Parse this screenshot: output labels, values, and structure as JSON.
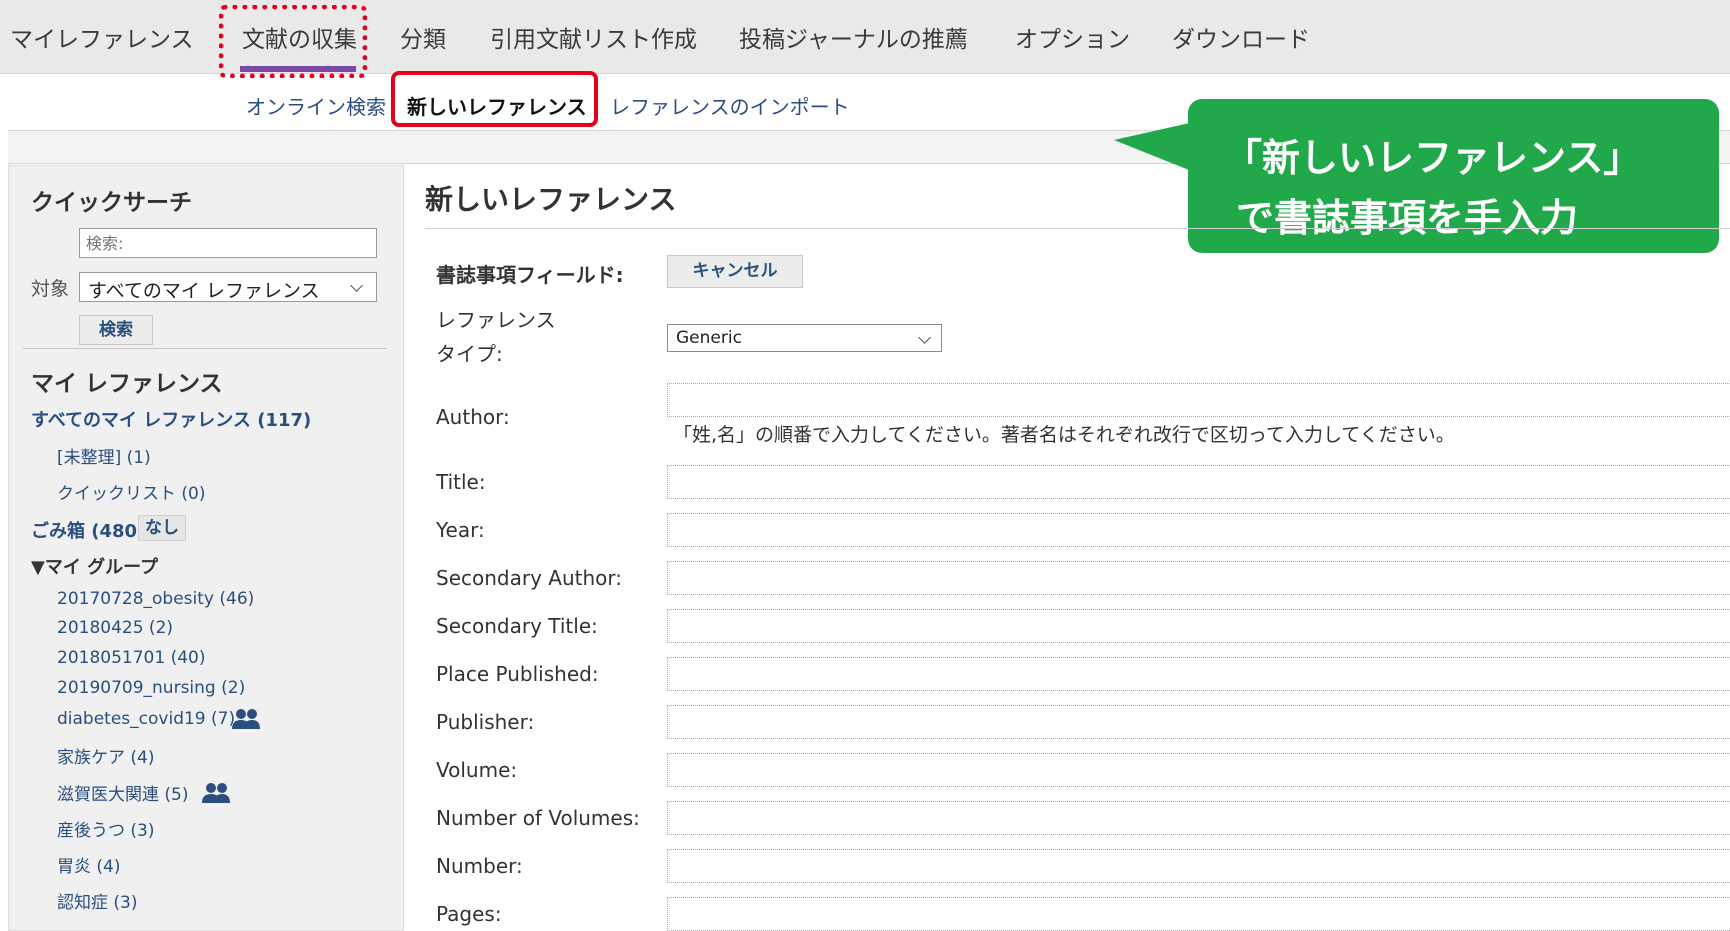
{
  "topnav": {
    "items": [
      "マイレファレンス",
      "文献の収集",
      "分類",
      "引用文献リスト作成",
      "投稿ジャーナルの推薦",
      "オプション",
      "ダウンロード"
    ]
  },
  "subnav": {
    "items": [
      "オンライン検索",
      "新しいレファレンス",
      "レファレンスのインポート"
    ]
  },
  "callout": {
    "line1": "「新しいレファレンス」",
    "line2": "で書誌事項を手入力",
    "color": "#21a84a"
  },
  "sidebar": {
    "quick_search_title": "クイックサーチ",
    "search_placeholder": "検索:",
    "target_label": "対象",
    "target_value": "すべてのマイ レファレンス",
    "search_button": "検索",
    "my_refs_title": "マイ レファレンス",
    "all_refs": "すべてのマイ レファレンス (117)",
    "unfiled": "[未整理] (1)",
    "quicklist": "クイックリスト (0)",
    "trash": "ごみ箱 (480)",
    "trash_empty": "なし",
    "my_groups": "▼マイ グループ",
    "groups": [
      {
        "label": "20170728_obesity (46)",
        "shared": false
      },
      {
        "label": "20180425 (2)",
        "shared": false
      },
      {
        "label": "2018051701 (40)",
        "shared": false
      },
      {
        "label": "20190709_nursing (2)",
        "shared": false
      },
      {
        "label": "diabetes_covid19 (7)",
        "shared": true
      },
      {
        "label": "家族ケア (4)",
        "shared": false
      },
      {
        "label": "滋賀医大関連 (5)",
        "shared": true
      },
      {
        "label": "産後うつ (3)",
        "shared": false
      },
      {
        "label": "胃炎 (4)",
        "shared": false
      },
      {
        "label": "認知症 (3)",
        "shared": false
      }
    ]
  },
  "main": {
    "title": "新しいレファレンス",
    "bib_fields_label": "書誌事項フィールド:",
    "cancel_button": "キャンセル",
    "ref_type_label_1": "レファレンス",
    "ref_type_label_2": "タイプ:",
    "ref_type_value": "Generic",
    "author_label": "Author:",
    "author_help": "「姓,名」の順番で入力してください。著者名はそれぞれ改行で区切って入力してください。",
    "fields": [
      "Title:",
      "Year:",
      "Secondary Author:",
      "Secondary Title:",
      "Place Published:",
      "Publisher:",
      "Volume:",
      "Number of Volumes:",
      "Number:",
      "Pages:"
    ]
  },
  "colors": {
    "link": "#2a4f7e",
    "highlight": "#e3001b",
    "active_underline": "#7a49a5"
  }
}
